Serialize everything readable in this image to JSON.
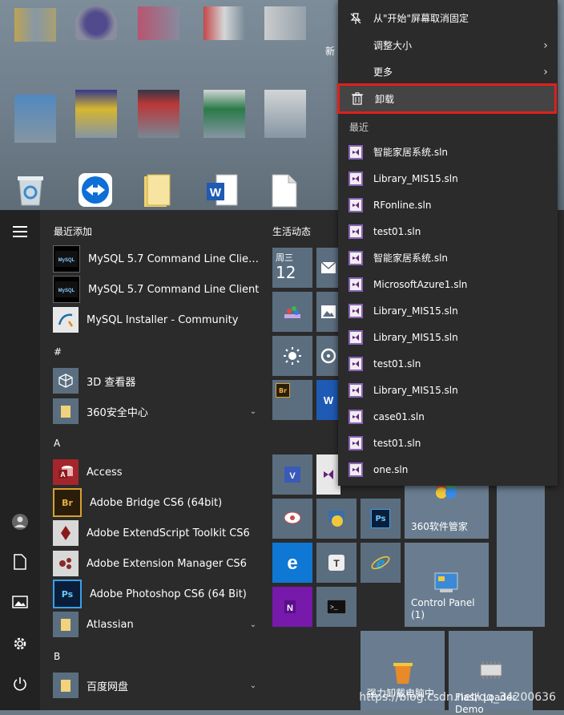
{
  "desktop": {
    "new_label": "新"
  },
  "start": {
    "section_recent": "最近添加",
    "section_live": "生活动态",
    "recent_apps": [
      {
        "label": "MySQL 5.7 Command Line Client...",
        "icon": "mysql-cmd-icon"
      },
      {
        "label": "MySQL 5.7 Command Line Client",
        "icon": "mysql-cmd-icon"
      },
      {
        "label": "MySQL Installer - Community",
        "icon": "mysql-installer-icon"
      }
    ],
    "letter_hash": "#",
    "hash_apps": [
      {
        "label": "3D 查看器",
        "icon": "3d-viewer-icon"
      },
      {
        "label": "360安全中心",
        "icon": "folder-icon"
      }
    ],
    "letter_a": "A",
    "a_apps": [
      {
        "label": "Access",
        "icon": "access-icon"
      },
      {
        "label": "Adobe Bridge CS6 (64bit)",
        "icon": "bridge-icon"
      },
      {
        "label": "Adobe ExtendScript Toolkit CS6",
        "icon": "extendscript-icon"
      },
      {
        "label": "Adobe Extension Manager CS6",
        "icon": "extension-manager-icon"
      },
      {
        "label": "Adobe Photoshop CS6 (64 Bit)",
        "icon": "photoshop-icon"
      },
      {
        "label": "Atlassian",
        "icon": "folder-icon"
      }
    ],
    "letter_b": "B",
    "b_apps": [
      {
        "label": "百度网盘",
        "icon": "folder-icon"
      }
    ]
  },
  "tiles": {
    "calendar_day": "周三",
    "calendar_date": "12",
    "t360": "360软件管家",
    "control_panel": "Control Panel\n(1)",
    "uninstaller": "强力卸载电脑中",
    "flash_loader": "Flash Loader\nDemo"
  },
  "context_menu": {
    "unpin": "从\"开始\"屏幕取消固定",
    "resize": "调整大小",
    "more": "更多",
    "uninstall": "卸载",
    "recent_title": "最近",
    "recent_files": [
      "智能家居系统.sln",
      "Library_MIS15.sln",
      "RFonline.sln",
      "test01.sln",
      "智能家居系统.sln",
      "MicrosoftAzure1.sln",
      "Library_MIS15.sln",
      "Library_MIS15.sln",
      "test01.sln",
      "Library_MIS15.sln",
      "case01.sln",
      "test01.sln",
      "one.sln"
    ]
  },
  "watermark": "https://blog.csdn.net/qq_34200636",
  "colors": {
    "accent_highlight": "#e0201b",
    "menu_bg": "#2b2b2b",
    "tile_bg": "#5b6e80"
  }
}
